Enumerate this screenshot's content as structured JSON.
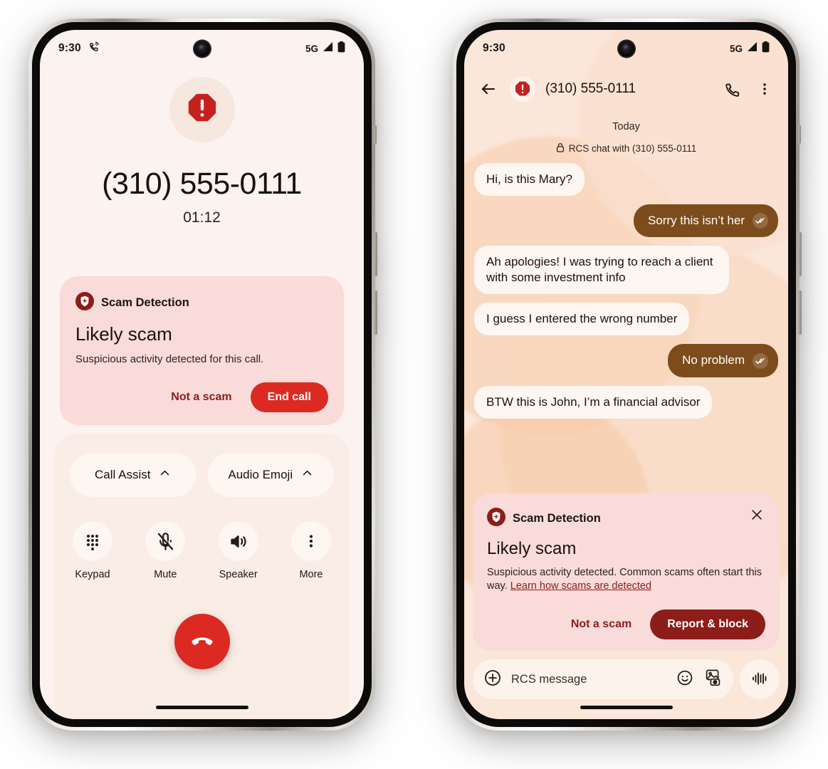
{
  "left_phone": {
    "status_bar": {
      "time": "9:30",
      "call_icon": "call-muted-icon",
      "network": "5G",
      "signal_icon": "signal-bars-icon",
      "battery_icon": "battery-full-icon"
    },
    "call": {
      "avatar_icon": "scam-octagon-warning-icon",
      "number": "(310) 555-0111",
      "duration": "01:12"
    },
    "scam_card": {
      "shield_icon": "scam-shield-icon",
      "header": "Scam Detection",
      "title": "Likely scam",
      "body": "Suspicious activity detected for this call.",
      "secondary_action": "Not a scam",
      "primary_action": "End call",
      "card_bg": "#F9DBDA",
      "primary_color": "#DC2A22"
    },
    "controls": {
      "chips": [
        {
          "label": "Call Assist",
          "icon": "chevron-up-icon"
        },
        {
          "label": "Audio Emoji",
          "icon": "chevron-up-icon"
        }
      ],
      "buttons": [
        {
          "label": "Keypad",
          "icon": "keypad-icon"
        },
        {
          "label": "Mute",
          "icon": "mic-off-icon"
        },
        {
          "label": "Speaker",
          "icon": "speaker-icon"
        },
        {
          "label": "More",
          "icon": "more-vertical-icon"
        }
      ],
      "end_call_icon": "end-call-icon"
    }
  },
  "right_phone": {
    "status_bar": {
      "time": "9:30",
      "network": "5G",
      "signal_icon": "signal-bars-icon",
      "battery_icon": "battery-full-icon"
    },
    "header": {
      "back_icon": "back-arrow-icon",
      "avatar_icon": "scam-octagon-warning-icon",
      "title": "(310) 555-0111",
      "call_icon": "phone-icon",
      "menu_icon": "more-vertical-icon"
    },
    "conversation": {
      "day_label": "Today",
      "rcs_note": "RCS chat with (310) 555-0111",
      "lock_icon": "lock-icon",
      "messages": [
        {
          "dir": "in",
          "text": "Hi, is this Mary?"
        },
        {
          "dir": "out",
          "text": "Sorry this isn’t her",
          "receipt_icon": "double-check-icon"
        },
        {
          "dir": "in",
          "text": "Ah apologies! I was trying to reach a client with some investment info"
        },
        {
          "dir": "in",
          "text": "I guess I entered the wrong number"
        },
        {
          "dir": "out",
          "text": "No problem",
          "receipt_icon": "double-check-icon"
        },
        {
          "dir": "in",
          "text": "BTW this is John, I’m a financial advisor"
        }
      ]
    },
    "scam_card": {
      "shield_icon": "scam-shield-icon",
      "header": "Scam Detection",
      "close_icon": "close-icon",
      "title": "Likely scam",
      "body": "Suspicious activity detected. Common scams often start this way. ",
      "link": "Learn how scams are detected",
      "secondary_action": "Not a scam",
      "primary_action": "Report & block",
      "card_bg": "#F9DBDA",
      "primary_color": "#8C1D18"
    },
    "compose": {
      "plus_icon": "plus-circle-icon",
      "placeholder": "RCS message",
      "emoji_icon": "emoji-smiley-icon",
      "gallery_icon": "gallery-camera-icon",
      "voice_icon": "voice-waveform-icon"
    }
  }
}
